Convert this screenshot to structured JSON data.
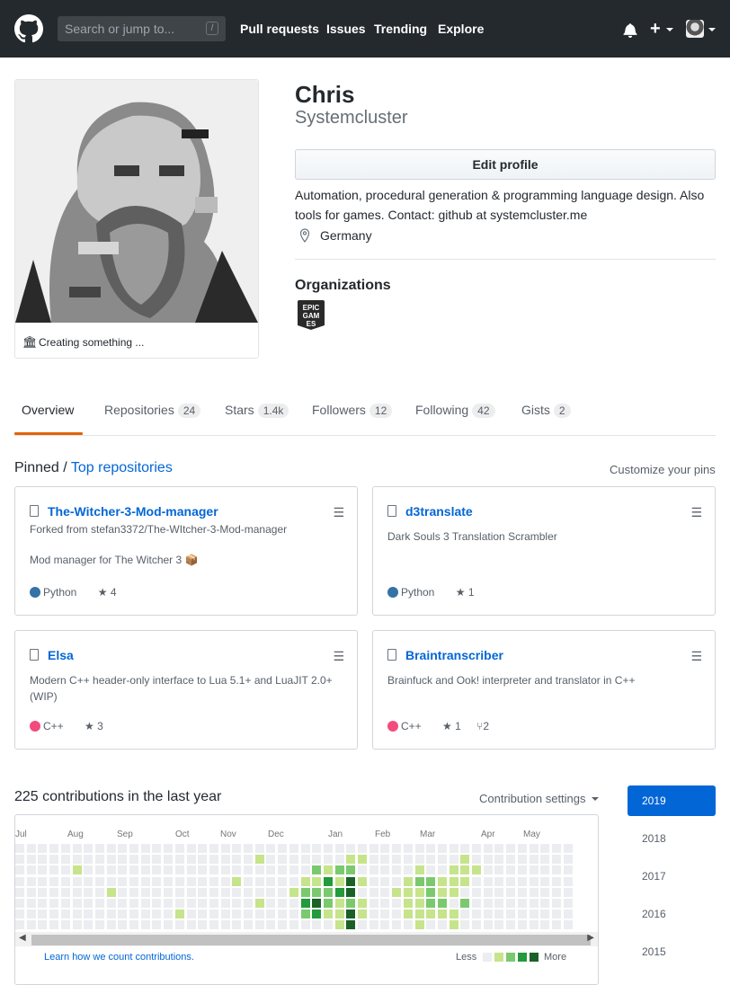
{
  "header": {
    "search_placeholder": "Search or jump to...",
    "slash_hint": "/",
    "nav": [
      "Pull requests",
      "Issues",
      "Trending",
      "Explore"
    ],
    "plus_label": "+"
  },
  "profile": {
    "status": "Creating something ...",
    "name": "Chris",
    "login": "Systemcluster",
    "edit_button": "Edit profile",
    "bio": "Automation, procedural generation & programming language design. Also tools for games. Contact: github at systemcluster.me",
    "location": "Germany",
    "organizations_title": "Organizations",
    "org_logo_text": "EPIC GAMES"
  },
  "tabs": [
    {
      "label": "Overview",
      "count": ""
    },
    {
      "label": "Repositories",
      "count": "24"
    },
    {
      "label": "Stars",
      "count": "1.4k"
    },
    {
      "label": "Followers",
      "count": "12"
    },
    {
      "label": "Following",
      "count": "42"
    },
    {
      "label": "Gists",
      "count": "2"
    }
  ],
  "pinned": {
    "title_prefix": "Pinned /",
    "title_link": "Top repositories",
    "customize": "Customize your pins",
    "repos": [
      {
        "name": "The-Witcher-3-Mod-manager",
        "fork": "Forked from stefan3372/The-WItcher-3-Mod-manager",
        "desc": "Mod manager for The Witcher 3 📦",
        "lang": "Python",
        "lang_color": "#3572A5",
        "stars": "4",
        "forks": ""
      },
      {
        "name": "d3translate",
        "fork": "",
        "desc": "Dark Souls 3 Translation Scrambler",
        "lang": "Python",
        "lang_color": "#3572A5",
        "stars": "1",
        "forks": ""
      },
      {
        "name": "Elsa",
        "fork": "",
        "desc": "Modern C++ header-only interface to Lua 5.1+ and LuaJIT 2.0+ (WIP)",
        "lang": "C++",
        "lang_color": "#f34b7d",
        "stars": "3",
        "forks": ""
      },
      {
        "name": "Braintranscriber",
        "fork": "",
        "desc": "Brainfuck and Ook! interpreter and translator in C++",
        "lang": "C++",
        "lang_color": "#f34b7d",
        "stars": "1",
        "forks": "2"
      }
    ]
  },
  "contributions": {
    "title": "225 contributions in the last year",
    "settings": "Contribution settings",
    "months": [
      "Jul",
      "Aug",
      "Sep",
      "Oct",
      "Nov",
      "Dec",
      "Jan",
      "Feb",
      "Mar",
      "Apr",
      "May"
    ],
    "learn": "Learn how we count contributions.",
    "less": "Less",
    "more": "More",
    "colors": [
      "#ebedf0",
      "#c6e48b",
      "#7bc96f",
      "#239a3b",
      "#196127"
    ],
    "years": [
      "2019",
      "2018",
      "2017",
      "2016",
      "2015"
    ]
  }
}
